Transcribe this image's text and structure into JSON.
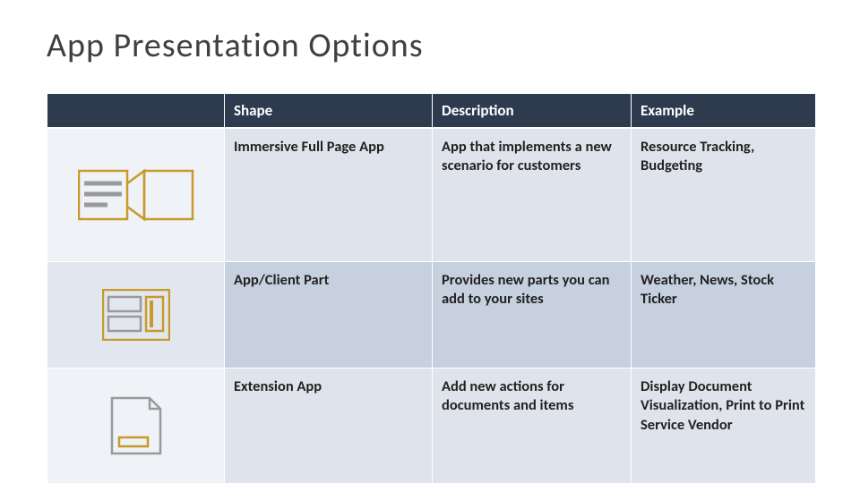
{
  "title": "App Presentation Options",
  "columns": {
    "shape": "Shape",
    "description": "Description",
    "example": "Example"
  },
  "rows": [
    {
      "icon": "immersive-icon",
      "shape": "Immersive Full Page App",
      "description": "App that implements a new scenario for customers",
      "example": "Resource Tracking, Budgeting"
    },
    {
      "icon": "app-part-icon",
      "shape": "App/Client Part",
      "description": "Provides new parts you can add to your sites",
      "example": "Weather, News, Stock Ticker"
    },
    {
      "icon": "extension-icon",
      "shape": "Extension App",
      "description": "Add new actions for documents and items",
      "example": "Display Document Visualization, Print to Print Service Vendor"
    }
  ]
}
